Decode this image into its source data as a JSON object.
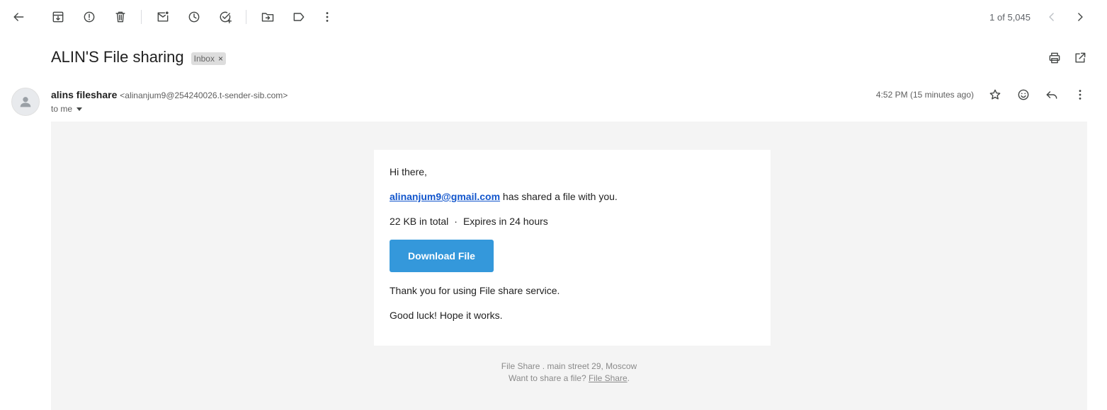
{
  "toolbar": {
    "icons": [
      "back-arrow-icon",
      "archive-icon",
      "report-spam-icon",
      "delete-icon",
      "mark-unread-icon",
      "snooze-icon",
      "add-task-icon",
      "move-to-icon",
      "label-icon",
      "more-vert-icon"
    ],
    "counter": "1 of 5,045"
  },
  "subject": {
    "title": "ALIN'S File sharing",
    "label": "Inbox",
    "remove": "×"
  },
  "message": {
    "sender_name": "alins fileshare",
    "sender_email": "<alinanjum9@254240026.t-sender-sib.com>",
    "to": "to me",
    "time": "4:52 PM (15 minutes ago)"
  },
  "email": {
    "greeting": "Hi there,",
    "sharer_link": "alinanjum9@gmail.com",
    "shared_text": " has shared a file with you.",
    "size": "22 KB in total",
    "separator": "·",
    "expires": "Expires in 24 hours",
    "download_label": "Download File",
    "thanks": "Thank you for using File share service.",
    "luck": "Good luck! Hope it works.",
    "footer_address": "File Share . main street 29, Moscow",
    "footer_prompt": "Want to share a file? ",
    "footer_link": "File Share",
    "footer_period": "."
  },
  "colors": {
    "button": "#3498db",
    "link": "#1155cc",
    "body_bg": "#f4f4f4"
  }
}
